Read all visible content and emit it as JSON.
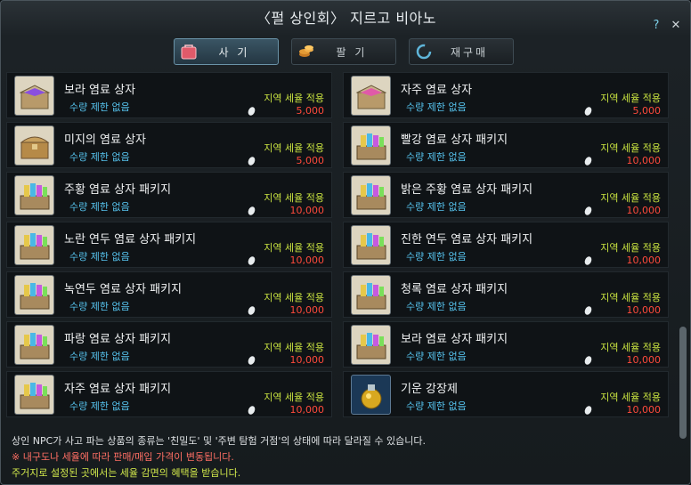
{
  "window": {
    "title": "〈펄 상인회〉 지르고 비아노",
    "help": "?",
    "close": "✕"
  },
  "tabs": [
    {
      "label": "사 기",
      "active": true,
      "icon": "bag-icon"
    },
    {
      "label": "팔 기",
      "active": false,
      "icon": "coins-icon"
    },
    {
      "label": "재구매",
      "active": false,
      "icon": "refresh-icon"
    }
  ],
  "items": [
    {
      "name": "보라 염료 상자",
      "limit": "수량 제한 없음",
      "tax": "지역 세율 적용",
      "price": "5,000",
      "icon": "purple-dye-chest-icon"
    },
    {
      "name": "자주 염료 상자",
      "limit": "수량 제한 없음",
      "tax": "지역 세율 적용",
      "price": "5,000",
      "icon": "magenta-dye-chest-icon"
    },
    {
      "name": "미지의 염료 상자",
      "limit": "수량 제한 없음",
      "tax": "지역 세율 적용",
      "price": "5,000",
      "icon": "mystery-chest-icon"
    },
    {
      "name": "빨강 염료 상자 패키지",
      "limit": "수량 제한 없음",
      "tax": "지역 세율 적용",
      "price": "10,000",
      "icon": "dye-package-icon"
    },
    {
      "name": "주황 염료 상자 패키지",
      "limit": "수량 제한 없음",
      "tax": "지역 세율 적용",
      "price": "10,000",
      "icon": "dye-package-icon"
    },
    {
      "name": "밝은 주황 염료 상자 패키지",
      "limit": "수량 제한 없음",
      "tax": "지역 세율 적용",
      "price": "10,000",
      "icon": "dye-package-icon"
    },
    {
      "name": "노란 연두 염료 상자 패키지",
      "limit": "수량 제한 없음",
      "tax": "지역 세율 적용",
      "price": "10,000",
      "icon": "dye-package-icon"
    },
    {
      "name": "진한 연두 염료 상자 패키지",
      "limit": "수량 제한 없음",
      "tax": "지역 세율 적용",
      "price": "10,000",
      "icon": "dye-package-icon"
    },
    {
      "name": "녹연두 염료 상자 패키지",
      "limit": "수량 제한 없음",
      "tax": "지역 세율 적용",
      "price": "10,000",
      "icon": "dye-package-icon"
    },
    {
      "name": "청록 염료 상자 패키지",
      "limit": "수량 제한 없음",
      "tax": "지역 세율 적용",
      "price": "10,000",
      "icon": "dye-package-icon"
    },
    {
      "name": "파랑 염료 상자 패키지",
      "limit": "수량 제한 없음",
      "tax": "지역 세율 적용",
      "price": "10,000",
      "icon": "dye-package-icon"
    },
    {
      "name": "보라 염료 상자 패키지",
      "limit": "수량 제한 없음",
      "tax": "지역 세율 적용",
      "price": "10,000",
      "icon": "dye-package-icon"
    },
    {
      "name": "자주 염료 상자 패키지",
      "limit": "수량 제한 없음",
      "tax": "지역 세율 적용",
      "price": "10,000",
      "icon": "dye-package-icon"
    },
    {
      "name": "기운 강장제",
      "limit": "수량 제한 없음",
      "tax": "지역 세율 적용",
      "price": "10,000",
      "icon": "tonic-potion-icon"
    }
  ],
  "footer": {
    "line1": "상인 NPC가 사고 파는 상품의 종류는 '친밀도' 및 '주변 탐험 거점'의 상태에 따라 달라질 수 있습니다.",
    "line2": "※ 내구도나 세율에 따라 판매/매입 가격이 변동됩니다.",
    "line3": "주거지로 설정된 곳에서는 세율 감면의 혜택을 받습니다."
  }
}
